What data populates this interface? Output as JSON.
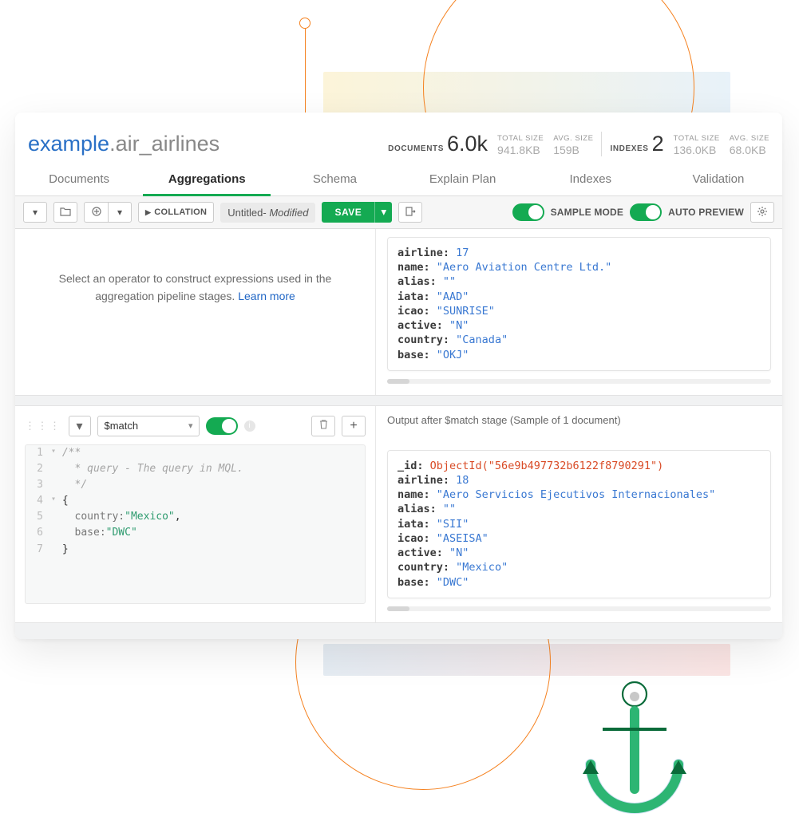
{
  "namespace": {
    "db": "example",
    "coll": ".air_airlines"
  },
  "stats": {
    "documents_label": "DOCUMENTS",
    "documents_value": "6.0k",
    "doc_total_size_label": "TOTAL SIZE",
    "doc_total_size_value": "941.8KB",
    "doc_avg_size_label": "AVG. SIZE",
    "doc_avg_size_value": "159B",
    "indexes_label": "INDEXES",
    "indexes_value": "2",
    "idx_total_size_label": "TOTAL SIZE",
    "idx_total_size_value": "136.0KB",
    "idx_avg_size_label": "AVG. SIZE",
    "idx_avg_size_value": "68.0KB"
  },
  "tabs": {
    "documents": "Documents",
    "aggregations": "Aggregations",
    "schema": "Schema",
    "explain": "Explain Plan",
    "indexes": "Indexes",
    "validation": "Validation"
  },
  "toolbar": {
    "collation": "COLLATION",
    "pipeline_name": "Untitled",
    "pipeline_state": "Modified",
    "save": "SAVE",
    "sample_mode": "SAMPLE MODE",
    "auto_preview": "AUTO PREVIEW"
  },
  "stage0": {
    "hint_line1": "Select an operator to construct expressions used in the",
    "hint_line2": "aggregation pipeline stages.",
    "learn_more": "Learn more",
    "doc": {
      "airline_k": "airline:",
      "airline_v": "17",
      "name_k": "name:",
      "name_v": "\"Aero Aviation Centre Ltd.\"",
      "alias_k": "alias:",
      "alias_v": "\"\"",
      "iata_k": "iata:",
      "iata_v": "\"AAD\"",
      "icao_k": "icao:",
      "icao_v": "\"SUNRISE\"",
      "active_k": "active:",
      "active_v": "\"N\"",
      "country_k": "country:",
      "country_v": "\"Canada\"",
      "base_k": "base:",
      "base_v": "\"OKJ\""
    }
  },
  "stage1": {
    "operator": "$match",
    "output_label": "Output after $match stage (Sample of 1 document)",
    "code": {
      "l1": "/**",
      "l2": " * query - The query in MQL.",
      "l3": " */",
      "l4": "{",
      "l5_key": "country:",
      "l5_val": "\"Mexico\"",
      "l5_tail": ",",
      "l6_key": "base:",
      "l6_val": "\"DWC\"",
      "l7": "}"
    },
    "doc": {
      "id_k": "_id:",
      "id_v": "ObjectId(\"56e9b497732b6122f8790291\")",
      "airline_k": "airline:",
      "airline_v": "18",
      "name_k": "name:",
      "name_v": "\"Aero Servicios Ejecutivos Internacionales\"",
      "alias_k": "alias:",
      "alias_v": "\"\"",
      "iata_k": "iata:",
      "iata_v": "\"SII\"",
      "icao_k": "icao:",
      "icao_v": "\"ASEISA\"",
      "active_k": "active:",
      "active_v": "\"N\"",
      "country_k": "country:",
      "country_v": "\"Mexico\"",
      "base_k": "base:",
      "base_v": "\"DWC\""
    }
  }
}
